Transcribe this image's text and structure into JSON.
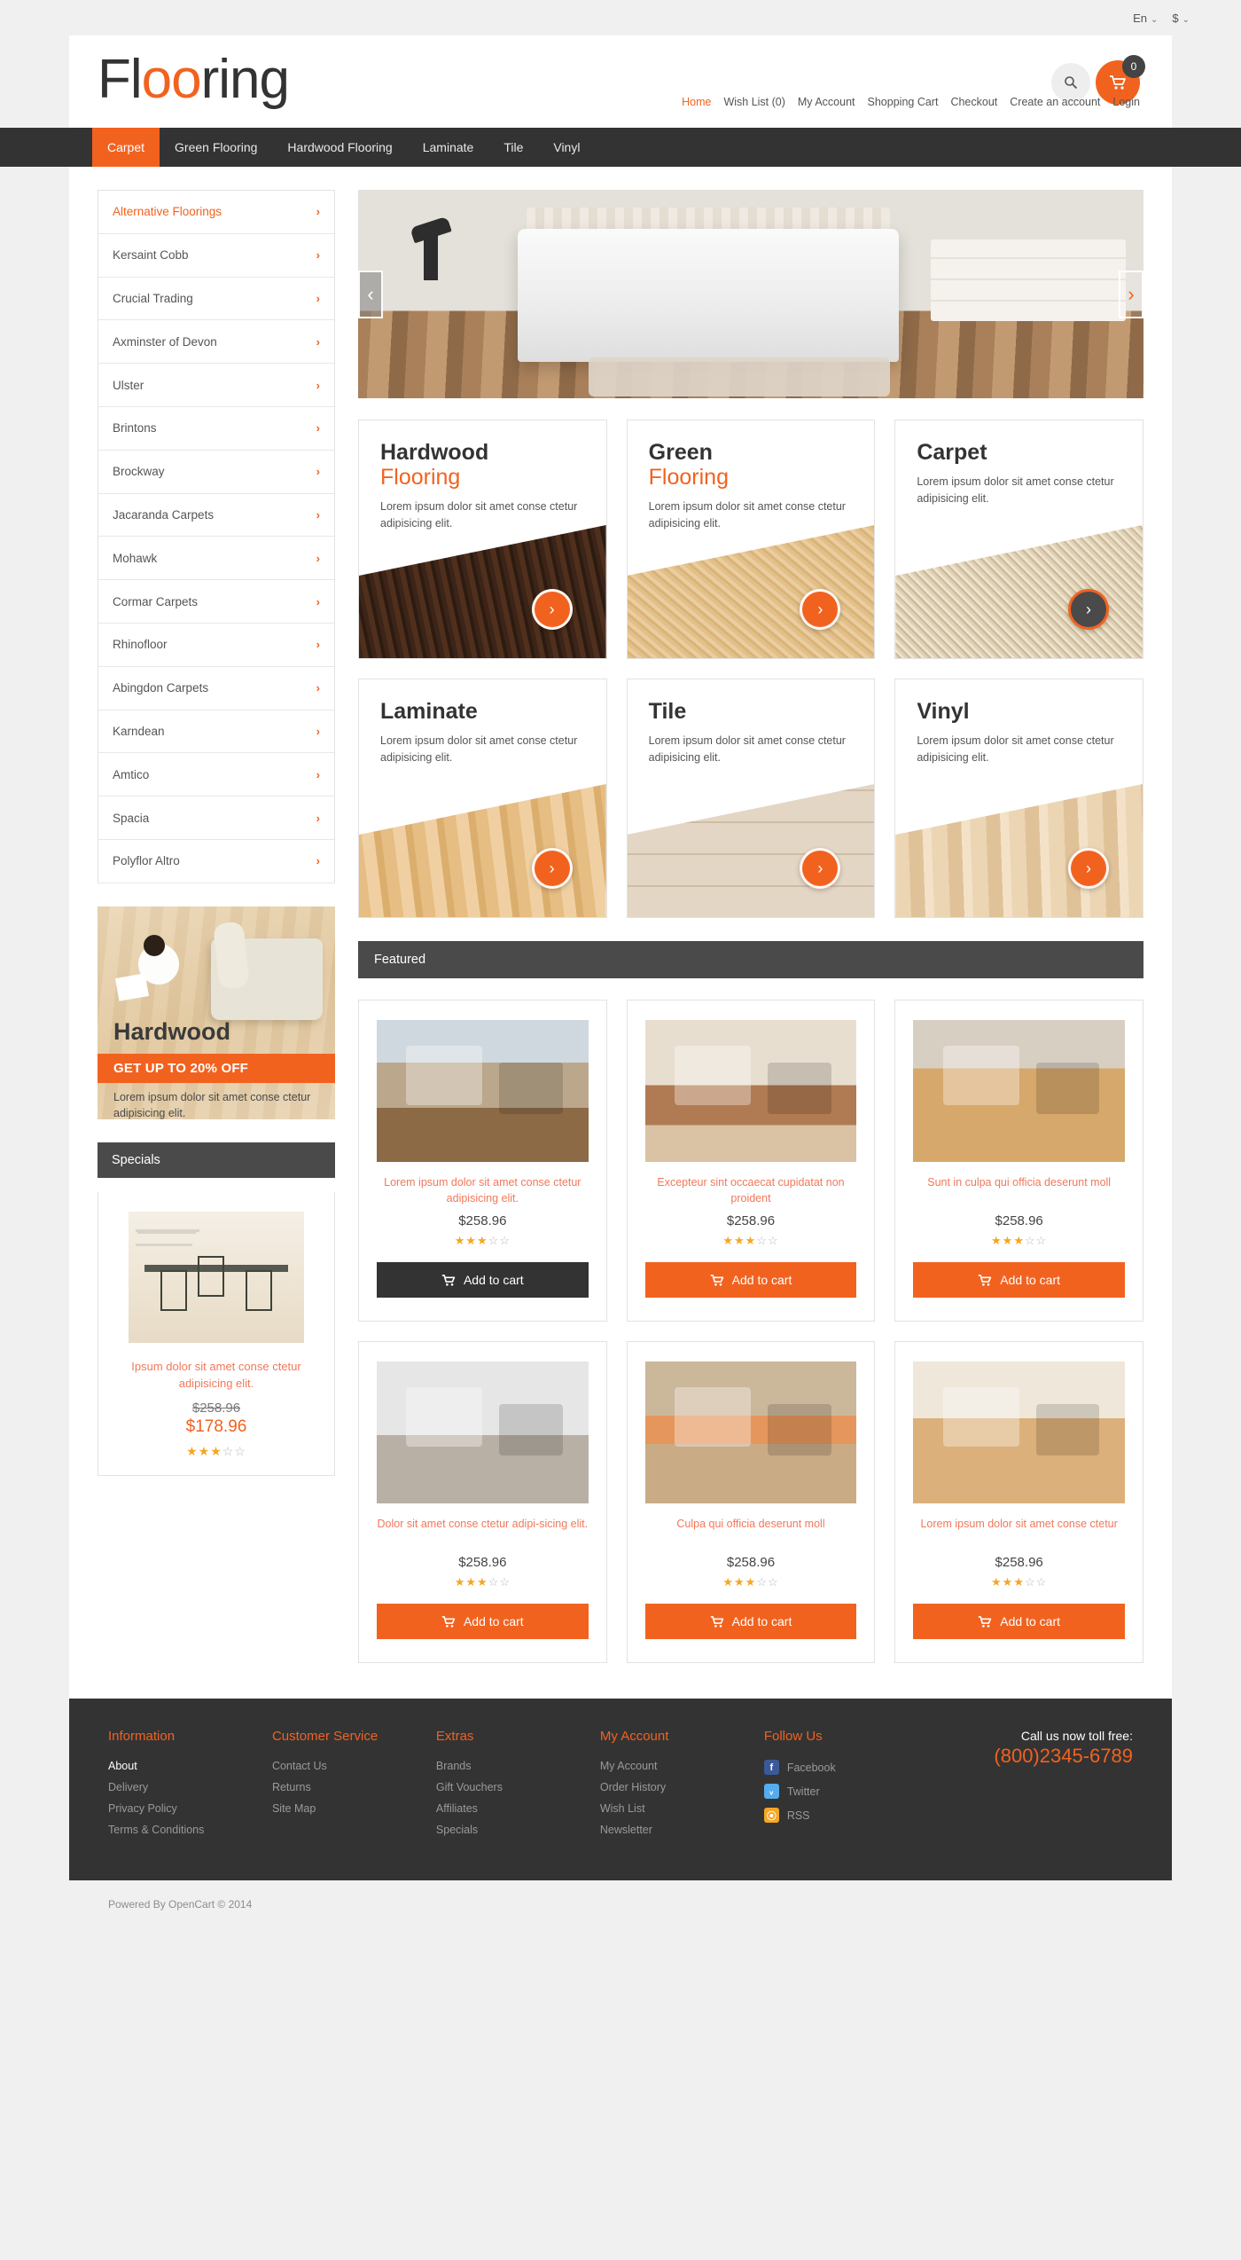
{
  "topbar": {
    "language": "En",
    "currency": "$",
    "caret": "⌄"
  },
  "header": {
    "logo_prefix": "Fl",
    "logo_accent": "oo",
    "logo_suffix": "ring",
    "search_icon": "search-icon",
    "cart_icon": "cart-icon",
    "cart_count": "0",
    "links": [
      {
        "label": "Home",
        "active": true
      },
      {
        "label": "Wish List (0)",
        "active": false
      },
      {
        "label": "My Account",
        "active": false
      },
      {
        "label": "Shopping Cart",
        "active": false
      },
      {
        "label": "Checkout",
        "active": false
      },
      {
        "label": "Create an account",
        "active": false
      },
      {
        "label": "Login",
        "active": false
      }
    ]
  },
  "nav": {
    "items": [
      {
        "label": "Carpet",
        "active": true
      },
      {
        "label": "Green Flooring",
        "active": false
      },
      {
        "label": "Hardwood Flooring",
        "active": false
      },
      {
        "label": "Laminate",
        "active": false
      },
      {
        "label": "Tile",
        "active": false
      },
      {
        "label": "Vinyl",
        "active": false
      }
    ]
  },
  "sidebar": {
    "categories": [
      {
        "label": "Alternative Floorings",
        "active": true
      },
      {
        "label": "Kersaint Cobb",
        "active": false
      },
      {
        "label": "Crucial Trading",
        "active": false
      },
      {
        "label": "Axminster of Devon",
        "active": false
      },
      {
        "label": "Ulster",
        "active": false
      },
      {
        "label": "Brintons",
        "active": false
      },
      {
        "label": "Brockway",
        "active": false
      },
      {
        "label": "Jacaranda Carpets",
        "active": false
      },
      {
        "label": "Mohawk",
        "active": false
      },
      {
        "label": "Cormar Carpets",
        "active": false
      },
      {
        "label": "Rhinofloor",
        "active": false
      },
      {
        "label": "Abingdon Carpets",
        "active": false
      },
      {
        "label": "Karndean",
        "active": false
      },
      {
        "label": "Amtico",
        "active": false
      },
      {
        "label": "Spacia",
        "active": false
      },
      {
        "label": "Polyflor Altro",
        "active": false
      }
    ],
    "chevron": "›",
    "promo": {
      "title": "Hardwood",
      "ribbon": "GET UP TO 20% OFF",
      "desc": "Lorem ipsum dolor sit amet conse ctetur adipisicing elit."
    },
    "specials": {
      "heading": "Specials",
      "product": {
        "name": "Ipsum dolor sit amet conse ctetur adipisicing elit.",
        "price_old": "$258.96",
        "price_new": "$178.96",
        "rating": 3,
        "rating_max": 5
      }
    }
  },
  "hero": {
    "prev_icon": "chevron-left-icon",
    "next_icon": "chevron-right-icon",
    "prev_glyph": "‹",
    "next_glyph": "›"
  },
  "category_cards": [
    {
      "title": "Hardwood",
      "subtitle": "Flooring",
      "desc": "Lorem ipsum dolor sit amet conse ctetur adipisicing elit.",
      "texture": "tex-hardwood",
      "btn_hovered": false
    },
    {
      "title": "Green",
      "subtitle": "Flooring",
      "desc": "Lorem ipsum dolor sit amet conse ctetur adipisicing elit.",
      "texture": "tex-green",
      "btn_hovered": false
    },
    {
      "title": "Carpet",
      "subtitle": "",
      "desc": "Lorem ipsum dolor sit amet conse ctetur adipisicing elit.",
      "texture": "tex-carpet",
      "btn_hovered": true
    },
    {
      "title": "Laminate",
      "subtitle": "",
      "desc": "Lorem ipsum dolor sit amet conse ctetur adipisicing elit.",
      "texture": "tex-laminate",
      "btn_hovered": false
    },
    {
      "title": "Tile",
      "subtitle": "",
      "desc": "Lorem ipsum dolor sit amet conse ctetur adipisicing elit.",
      "texture": "tex-tile",
      "btn_hovered": false
    },
    {
      "title": "Vinyl",
      "subtitle": "",
      "desc": "Lorem ipsum dolor sit amet conse ctetur adipisicing elit.",
      "texture": "tex-vinyl",
      "btn_hovered": false
    }
  ],
  "card_arrow_glyph": "›",
  "featured": {
    "heading": "Featured",
    "cart_glyph": "🛒",
    "products": [
      {
        "name": "Lorem ipsum dolor sit amet conse ctetur adipisicing elit.",
        "price": "$258.96",
        "rating": 3,
        "rating_max": 5,
        "button": "Add to cart",
        "button_dark": true,
        "img": "pi-1"
      },
      {
        "name": "Excepteur sint occaecat cupidatat non proident",
        "price": "$258.96",
        "rating": 3,
        "rating_max": 5,
        "button": "Add to cart",
        "button_dark": false,
        "img": "pi-2"
      },
      {
        "name": "Sunt in culpa qui officia deserunt moll",
        "price": "$258.96",
        "rating": 3,
        "rating_max": 5,
        "button": "Add to cart",
        "button_dark": false,
        "img": "pi-3"
      },
      {
        "name": "Dolor sit amet conse ctetur adipi-sicing elit.",
        "price": "$258.96",
        "rating": 3,
        "rating_max": 5,
        "button": "Add to cart",
        "button_dark": false,
        "img": "pi-4"
      },
      {
        "name": "Culpa qui officia deserunt moll",
        "price": "$258.96",
        "rating": 3,
        "rating_max": 5,
        "button": "Add to cart",
        "button_dark": false,
        "img": "pi-5"
      },
      {
        "name": "Lorem ipsum dolor sit amet conse ctetur",
        "price": "$258.96",
        "rating": 3,
        "rating_max": 5,
        "button": "Add to cart",
        "button_dark": false,
        "img": "pi-6"
      }
    ]
  },
  "footer": {
    "columns": [
      {
        "title": "Information",
        "items": [
          {
            "label": "About",
            "active": true
          },
          {
            "label": "Delivery",
            "active": false
          },
          {
            "label": "Privacy Policy",
            "active": false
          },
          {
            "label": "Terms & Conditions",
            "active": false
          }
        ]
      },
      {
        "title": "Customer Service",
        "items": [
          {
            "label": "Contact Us",
            "active": false
          },
          {
            "label": "Returns",
            "active": false
          },
          {
            "label": "Site Map",
            "active": false
          }
        ]
      },
      {
        "title": "Extras",
        "items": [
          {
            "label": "Brands",
            "active": false
          },
          {
            "label": "Gift Vouchers",
            "active": false
          },
          {
            "label": "Affiliates",
            "active": false
          },
          {
            "label": "Specials",
            "active": false
          }
        ]
      },
      {
        "title": "My Account",
        "items": [
          {
            "label": "My Account",
            "active": false
          },
          {
            "label": "Order History",
            "active": false
          },
          {
            "label": "Wish List",
            "active": false
          },
          {
            "label": "Newsletter",
            "active": false
          }
        ]
      }
    ],
    "follow": {
      "title": "Follow Us",
      "items": [
        {
          "label": "Facebook",
          "icon": "facebook-icon",
          "glyph": "f",
          "cls": "soc-fb"
        },
        {
          "label": "Twitter",
          "icon": "twitter-icon",
          "glyph": "ᵥ",
          "cls": "soc-tw"
        },
        {
          "label": "RSS",
          "icon": "rss-icon",
          "glyph": "⦿",
          "cls": "soc-rss"
        }
      ]
    },
    "phone_label": "Call us now toll free:",
    "phone_number": "(800)2345-6789"
  },
  "copyright": "Powered By OpenCart © 2014"
}
